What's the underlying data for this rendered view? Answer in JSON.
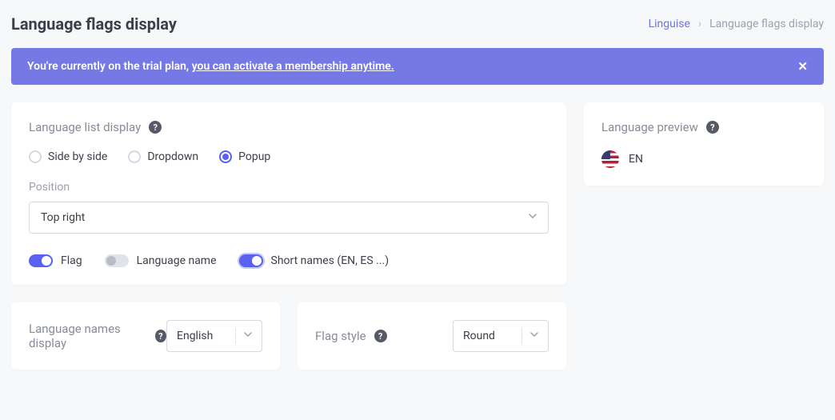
{
  "header": {
    "title": "Language flags display",
    "breadcrumb": {
      "root": "Linguise",
      "current": "Language flags display"
    }
  },
  "banner": {
    "text": "You're currently on the trial plan, ",
    "link": "you can activate a membership anytime."
  },
  "listDisplay": {
    "title": "Language list display",
    "options": {
      "sideBySide": "Side by side",
      "dropdown": "Dropdown",
      "popup": "Popup"
    },
    "position": {
      "label": "Position",
      "value": "Top right"
    },
    "toggles": {
      "flag": "Flag",
      "languageName": "Language name",
      "shortNames": "Short names (EN, ES ...)"
    }
  },
  "preview": {
    "title": "Language preview",
    "item": {
      "code": "EN"
    }
  },
  "namesDisplay": {
    "title": "Language names display",
    "value": "English"
  },
  "flagStyle": {
    "title": "Flag style",
    "value": "Round"
  }
}
